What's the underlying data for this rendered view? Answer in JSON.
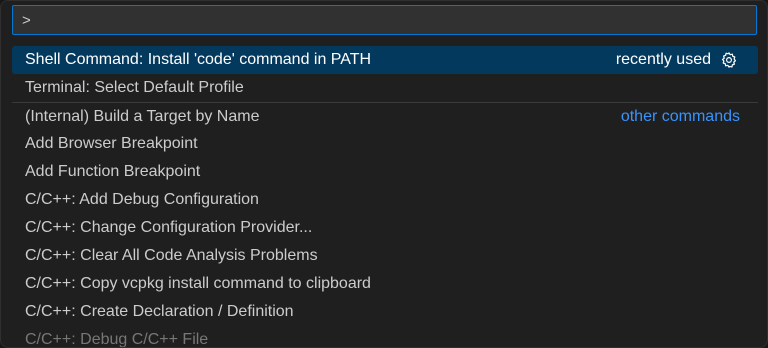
{
  "search": {
    "value": ">",
    "placeholder": ""
  },
  "colors": {
    "accent": "#0078d4",
    "selection": "#04395e",
    "link": "#3794ff"
  },
  "items": [
    {
      "label": "Shell Command: Install 'code' command in PATH",
      "right": "recently used",
      "icon": "gear-icon"
    },
    {
      "label": "Terminal: Select Default Profile"
    },
    {
      "label": "(Internal) Build a Target by Name",
      "right": "other commands"
    },
    {
      "label": "Add Browser Breakpoint"
    },
    {
      "label": "Add Function Breakpoint"
    },
    {
      "label": "C/C++: Add Debug Configuration"
    },
    {
      "label": "C/C++: Change Configuration Provider..."
    },
    {
      "label": "C/C++: Clear All Code Analysis Problems"
    },
    {
      "label": "C/C++: Copy vcpkg install command to clipboard"
    },
    {
      "label": "C/C++: Create Declaration / Definition"
    },
    {
      "label": "C/C++: Debug C/C++ File"
    }
  ]
}
